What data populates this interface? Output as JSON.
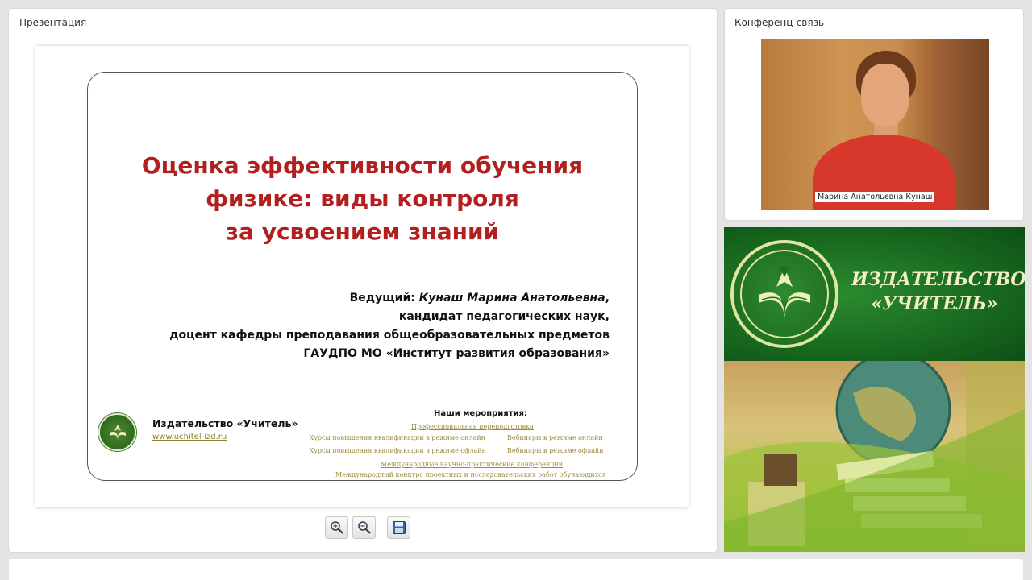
{
  "presentation": {
    "panel_title": "Презентация",
    "slide": {
      "title_lines": [
        "Оценка эффективности обучения",
        "физике: виды контроля",
        "за усвоением знаний"
      ],
      "presenter_prefix": "Ведущий: ",
      "presenter_name": "Кунаш Марина Анатольевна",
      "presenter_suffix": ",",
      "presenter_lines": [
        "кандидат педагогических наук,",
        "доцент кафедры преподавания общеобразовательных предметов",
        "ГАУДПО МО «Институт развития образования»"
      ],
      "footer_publisher": "Издательство «Учитель»",
      "footer_url": "www.uchitel-izd.ru",
      "events_title": "Наши мероприятия:",
      "events": [
        "Профессиональная переподготовка",
        "Курсы повышения квалификации в режиме онлайн",
        "Вебинары в режиме онлайн",
        "Курсы повышения квалификации в режиме офлайн",
        "Вебинары в режиме офлайн",
        "Международные научно-практические конференции",
        "Международный конкурс проектных и исследовательских работ обучающихся"
      ]
    },
    "toolbar": {
      "zoom_in_icon": "zoom-in-icon",
      "zoom_out_icon": "zoom-out-icon",
      "save_icon": "save-icon"
    }
  },
  "conference": {
    "panel_title": "Конференц-связь",
    "participant_name": "Марина Анатольевна Кунаш"
  },
  "ad": {
    "line1": "ИЗДАТЕЛЬСТВО",
    "line2": "«УЧИТЕЛЬ»"
  },
  "colors": {
    "title_red": "#b21f1f",
    "ad_green": "#1e6e21",
    "link_gold": "#9b8a3e"
  }
}
